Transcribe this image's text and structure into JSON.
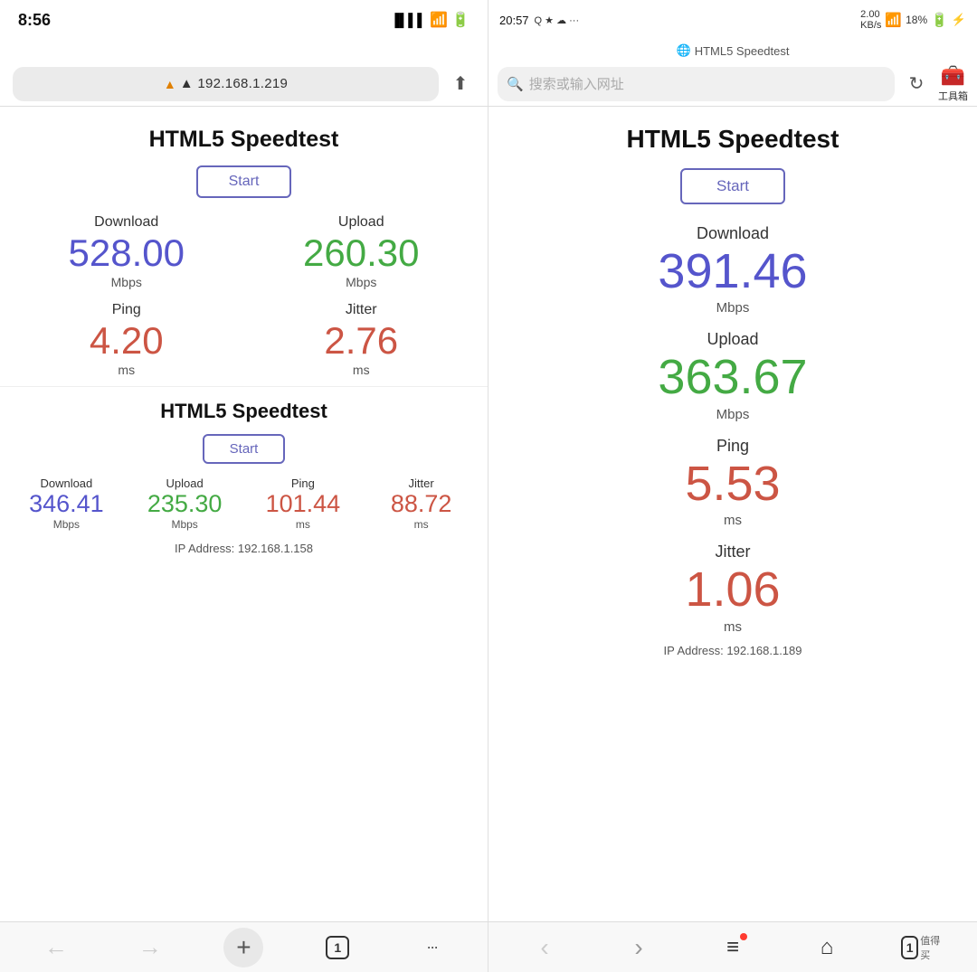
{
  "left_status": {
    "time": "8:56"
  },
  "right_status": {
    "time": "20:57",
    "signal": "2.00 KB/s",
    "wifi": "WiFi",
    "battery": "18%",
    "icons": "Q ★ ☁ ···"
  },
  "left_url": {
    "address": "▲ 192.168.1.219",
    "share_icon": "⬆"
  },
  "right_url": {
    "placeholder": "搜索或输入网址",
    "search_icon": "🔍",
    "refresh_icon": "↻",
    "toolbox_label": "工具箱",
    "tab_title": "HTML5 Speedtest"
  },
  "left_panel": {
    "speedtest1": {
      "title": "HTML5 Speedtest",
      "start_btn": "Start",
      "download_label": "Download",
      "download_value": "528.00",
      "download_unit": "Mbps",
      "upload_label": "Upload",
      "upload_value": "260.30",
      "upload_unit": "Mbps",
      "ping_label": "Ping",
      "ping_value": "4.20",
      "ping_unit": "ms",
      "jitter_label": "Jitter",
      "jitter_value": "2.76",
      "jitter_unit": "ms"
    },
    "speedtest2": {
      "title": "HTML5 Speedtest",
      "start_btn": "Start",
      "download_label": "Download",
      "download_value": "346.41",
      "download_unit": "Mbps",
      "upload_label": "Upload",
      "upload_value": "235.30",
      "upload_unit": "Mbps",
      "ping_label": "Ping",
      "ping_value": "101.44",
      "ping_unit": "ms",
      "jitter_label": "Jitter",
      "jitter_value": "88.72",
      "jitter_unit": "ms",
      "ip_address": "IP Address: 192.168.1.158"
    }
  },
  "right_panel": {
    "speedtest": {
      "title": "HTML5 Speedtest",
      "start_btn": "Start",
      "download_label": "Download",
      "download_value": "391.46",
      "download_unit": "Mbps",
      "upload_label": "Upload",
      "upload_value": "363.67",
      "upload_unit": "Mbps",
      "ping_label": "Ping",
      "ping_value": "5.53",
      "ping_unit": "ms",
      "jitter_label": "Jitter",
      "jitter_value": "1.06",
      "jitter_unit": "ms",
      "ip_address": "IP Address: 192.168.1.189"
    }
  },
  "left_toolbar": {
    "back": "←",
    "forward": "→",
    "new_tab": "+",
    "tabs": "1",
    "more": "···"
  },
  "right_toolbar": {
    "back": "‹",
    "forward": "›",
    "menu": "≡",
    "home": "⌂",
    "tabs": "1"
  }
}
